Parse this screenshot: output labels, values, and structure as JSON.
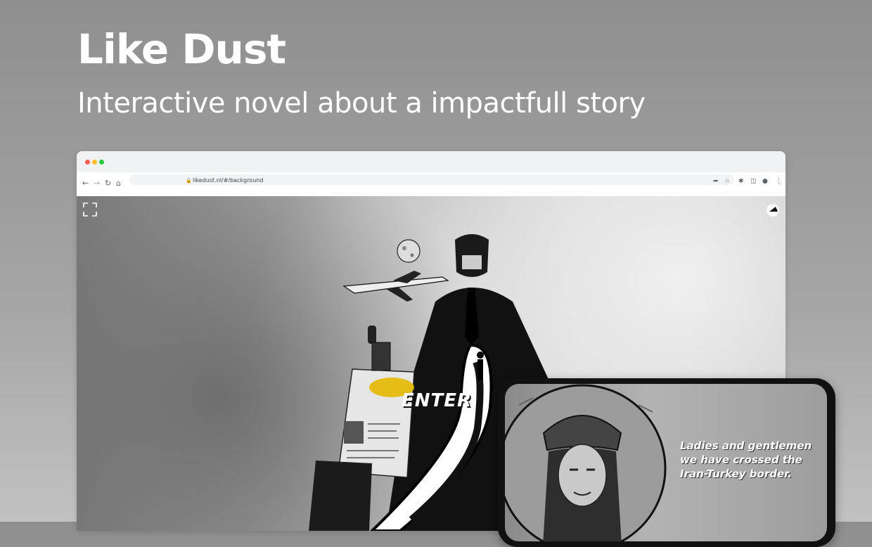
{
  "hero": {
    "title": "Like Dust",
    "subtitle": "Interactive novel about a impactfull story"
  },
  "browser": {
    "url": "likedust.nl/#/background",
    "traffic_lights": [
      "#ff5f57",
      "#febc2e",
      "#28c840"
    ]
  },
  "artwork": {
    "enter_label": "ENTER"
  },
  "phone": {
    "caption_lines": [
      "Ladies and gentlemen",
      "we have crossed the",
      "Iran-Turkey border."
    ]
  },
  "colors": {
    "background": "#9a9a9a",
    "text": "#ffffff"
  }
}
